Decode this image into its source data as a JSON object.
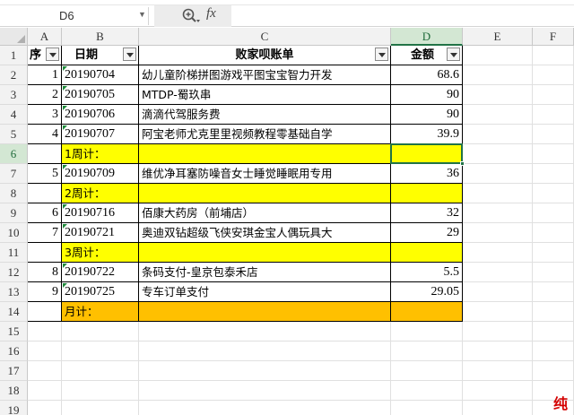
{
  "formula_bar": {
    "name_box": "D6",
    "fx_label": "fx",
    "formula": ""
  },
  "columns": [
    "A",
    "B",
    "C",
    "D",
    "E",
    "F"
  ],
  "selected_column": "D",
  "selected_row": "6",
  "header": {
    "seq": "序",
    "date": "日期",
    "desc": "败家呗账单",
    "amount": "金额"
  },
  "rows": [
    {
      "row": "2",
      "seq": "1",
      "date": "20190704",
      "desc": "幼儿童阶梯拼图游戏平图宝宝智力开发",
      "amount": "68.6",
      "style": "normal"
    },
    {
      "row": "3",
      "seq": "2",
      "date": "20190705",
      "desc": "MTDP-蜀玖串",
      "amount": "90",
      "style": "normal"
    },
    {
      "row": "4",
      "seq": "3",
      "date": "20190706",
      "desc": "滴滴代驾服务费",
      "amount": "90",
      "style": "normal"
    },
    {
      "row": "5",
      "seq": "4",
      "date": "20190707",
      "desc": "阿宝老师尤克里里视频教程零基础自学",
      "amount": "39.9",
      "style": "normal"
    },
    {
      "row": "6",
      "seq": "",
      "date": "1周计：",
      "desc": "",
      "amount": "",
      "style": "yellow"
    },
    {
      "row": "7",
      "seq": "5",
      "date": "20190709",
      "desc": "维优净耳塞防噪音女士睡觉睡眠用专用",
      "amount": "36",
      "style": "normal"
    },
    {
      "row": "8",
      "seq": "",
      "date": "2周计：",
      "desc": "",
      "amount": "",
      "style": "yellow"
    },
    {
      "row": "9",
      "seq": "6",
      "date": "20190716",
      "desc": "佰康大药房（前埔店）",
      "amount": "32",
      "style": "normal"
    },
    {
      "row": "10",
      "seq": "7",
      "date": "20190721",
      "desc": "奥迪双钻超级飞侠安琪金宝人偶玩具大",
      "amount": "29",
      "style": "normal"
    },
    {
      "row": "11",
      "seq": "",
      "date": "3周计：",
      "desc": "",
      "amount": "",
      "style": "yellow"
    },
    {
      "row": "12",
      "seq": "8",
      "date": "20190722",
      "desc": "条码支付-皇京包泰禾店",
      "amount": "5.5",
      "style": "normal"
    },
    {
      "row": "13",
      "seq": "9",
      "date": "20190725",
      "desc": "专车订单支付",
      "amount": "29.05",
      "style": "normal"
    },
    {
      "row": "14",
      "seq": "",
      "date": "月计：",
      "desc": "",
      "amount": "",
      "style": "orange"
    }
  ],
  "empty_rows": [
    "15",
    "16",
    "17",
    "18",
    "19"
  ],
  "corner_text": "纯",
  "colors": {
    "weekly_subtotal": "#ffff00",
    "monthly_total": "#ffc000",
    "selection": "#217346"
  }
}
